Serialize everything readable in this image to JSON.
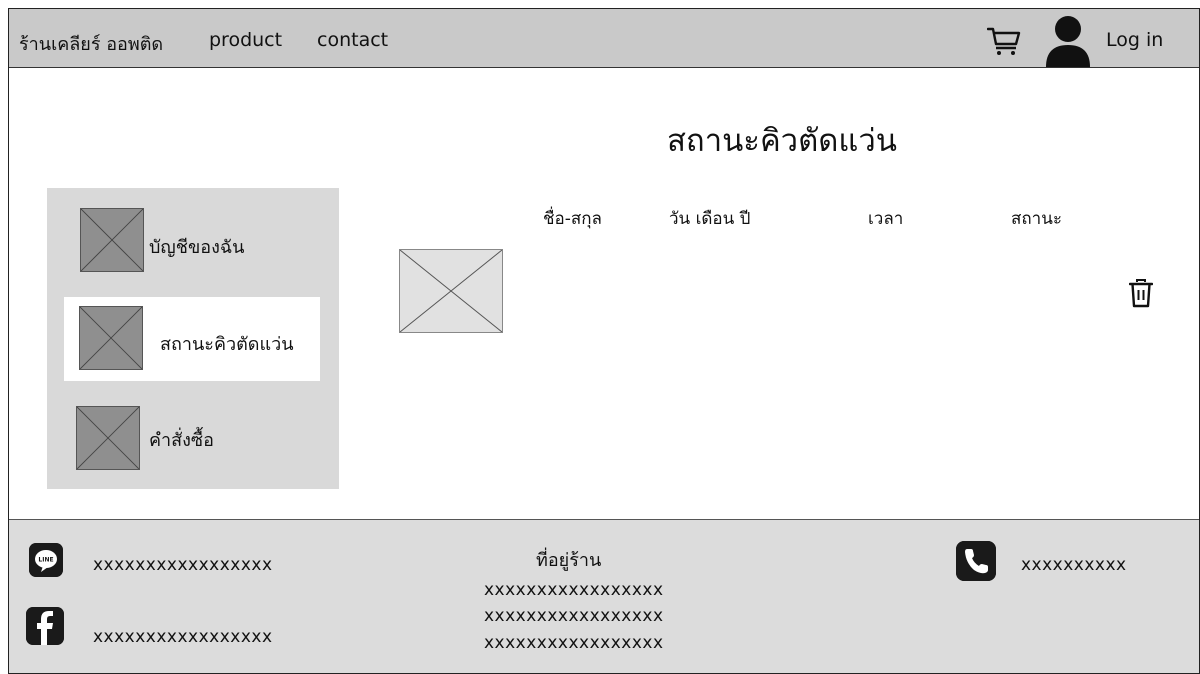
{
  "header": {
    "brand": "ร้านเคลียร์ ออพติด",
    "nav": {
      "product": "product",
      "contact": "contact"
    },
    "login_label": "Log in",
    "icons": [
      "cart-icon",
      "user-icon"
    ]
  },
  "main": {
    "title": "สถานะคิวตัดแว่น",
    "sidebar": {
      "items": [
        {
          "label": "บัญชีของฉัน",
          "active": false
        },
        {
          "label": "สถานะคิวตัดแว่น",
          "active": true
        },
        {
          "label": "คำสั่งซื้อ",
          "active": false
        }
      ]
    },
    "table": {
      "headers": [
        "ชื่อ-สกุล",
        "วัน เดือน ปี",
        "เวลา",
        "สถานะ"
      ],
      "rows": []
    }
  },
  "footer": {
    "line": "xxxxxxxxxxxxxxxxx",
    "facebook": "xxxxxxxxxxxxxxxxx",
    "address_title": "ที่อยู่ร้าน",
    "address_lines": [
      "xxxxxxxxxxxxxxxxx",
      "xxxxxxxxxxxxxxxxx",
      "xxxxxxxxxxxxxxxxx"
    ],
    "phone": "xxxxxxxxxx",
    "icons": [
      "line-icon",
      "facebook-icon",
      "phone-icon"
    ]
  },
  "colors": {
    "header_bg": "#c9c9c9",
    "sidebar_bg": "#d9d9d9",
    "footer_bg": "#dcdcdc",
    "placeholder_dark": "#8f8f8f",
    "placeholder_light": "#e1e1e1"
  }
}
